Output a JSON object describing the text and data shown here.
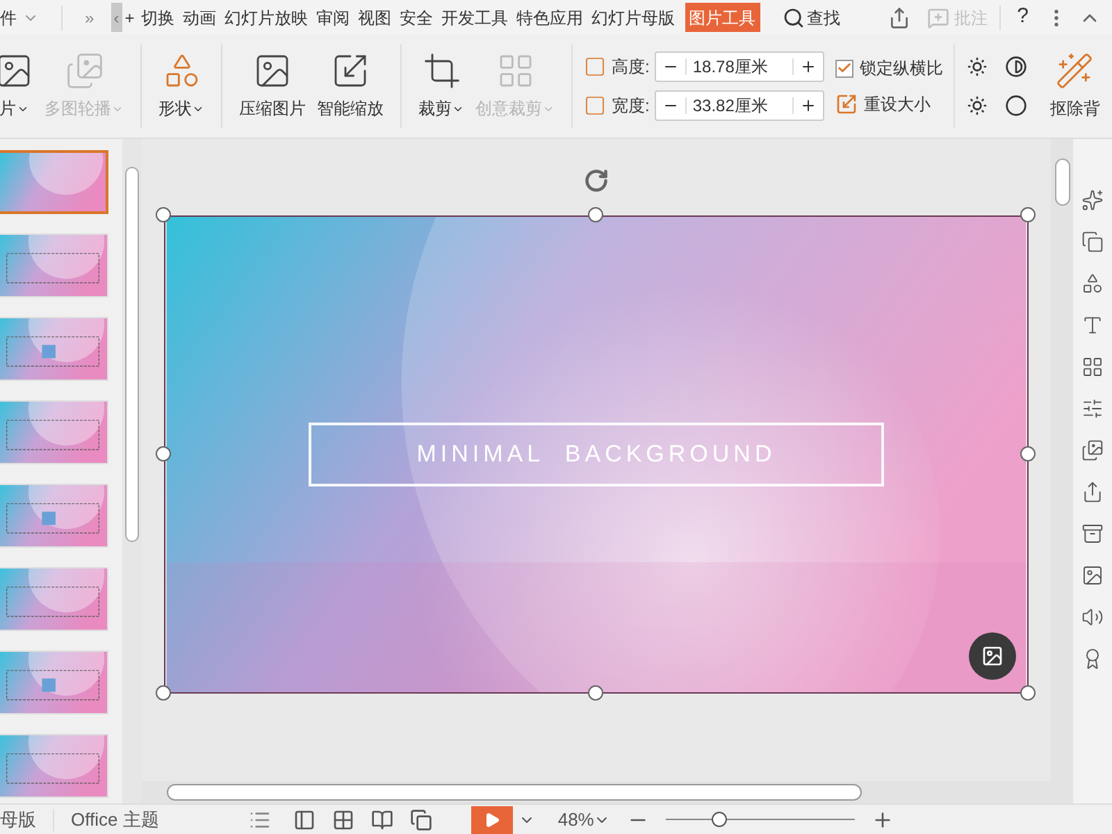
{
  "menu_bar": {
    "file_label": "件",
    "more_label": "»",
    "scroll_left_label": "‹",
    "plus_label": "+",
    "tabs": [
      {
        "label": "切换",
        "selected": false
      },
      {
        "label": "动画",
        "selected": false
      },
      {
        "label": "幻灯片放映",
        "selected": false
      },
      {
        "label": "审阅",
        "selected": false
      },
      {
        "label": "视图",
        "selected": false
      },
      {
        "label": "安全",
        "selected": false
      },
      {
        "label": "开发工具",
        "selected": false
      },
      {
        "label": "特色应用",
        "selected": false
      },
      {
        "label": "幻灯片母版",
        "selected": false
      },
      {
        "label": "图片工具",
        "selected": true
      }
    ],
    "search_label": "查找",
    "comment": {
      "label": "批注",
      "disabled": true
    },
    "help_label": "?"
  },
  "ribbon": {
    "buttons": [
      {
        "kind": "picture",
        "label": "片",
        "disabled": false
      },
      {
        "kind": "carousel",
        "label": "多图轮播",
        "disabled": true
      },
      {
        "kind": "shape",
        "label": "形状",
        "disabled": false
      },
      {
        "kind": "compress",
        "label": "压缩图片",
        "disabled": false
      },
      {
        "kind": "smart",
        "label": "智能缩放",
        "disabled": false
      },
      {
        "kind": "crop",
        "label": "裁剪",
        "disabled": false
      },
      {
        "kind": "creative",
        "label": "创意裁剪",
        "disabled": true
      }
    ],
    "height": {
      "label": "高度:",
      "value": "18.78厘米"
    },
    "width": {
      "label": "宽度:",
      "value": "33.82厘米"
    },
    "lock_ratio": {
      "label": "锁定纵横比",
      "checked": true
    },
    "reset_size": {
      "label": "重设大小"
    },
    "remove_bg": {
      "label": "抠除背"
    }
  },
  "thumbnails": [
    {
      "selected": true
    },
    {
      "selected": false
    },
    {
      "selected": false
    },
    {
      "selected": false
    },
    {
      "selected": false
    },
    {
      "selected": false
    },
    {
      "selected": false
    },
    {
      "selected": false
    }
  ],
  "slide": {
    "title": "MINIMAL  BACKGROUND"
  },
  "status_bar": {
    "master_label": "母版",
    "theme_label": "Office 主题",
    "zoom": "48%",
    "zoom_slider": {
      "level": 0.28
    }
  }
}
